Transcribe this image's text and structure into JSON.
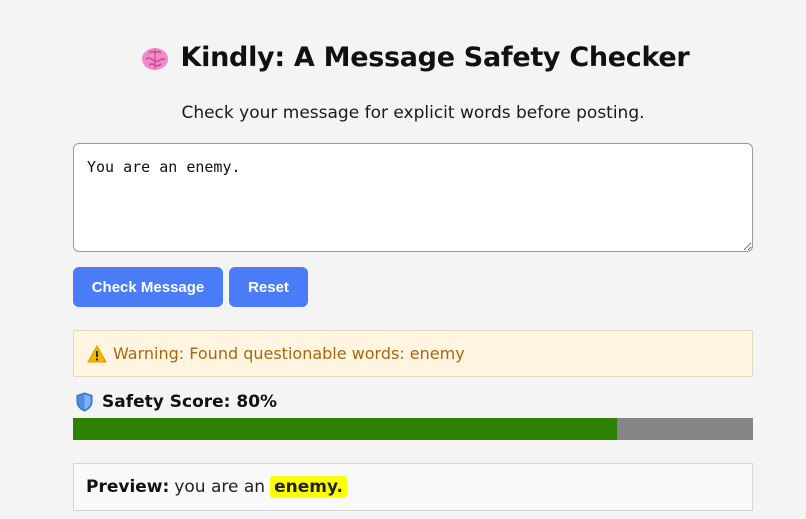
{
  "header": {
    "title": "Kindly: A Message Safety Checker",
    "title_icon": "brain-icon",
    "subtitle": "Check your message for explicit words before posting."
  },
  "message_input": {
    "value": "You are an enemy."
  },
  "buttons": {
    "check_label": "Check Message",
    "reset_label": "Reset"
  },
  "warning": {
    "icon": "warning-icon",
    "text": "Warning: Found questionable words: enemy"
  },
  "safety_score": {
    "icon": "shield-icon",
    "label": "Safety Score: 80%",
    "value": 0.8
  },
  "preview": {
    "label": "Preview:",
    "text": "you are an",
    "flagged": "enemy."
  },
  "colors": {
    "accent": "#4a7cf7",
    "score_fill": "#2e8203",
    "score_track": "#858585",
    "warning_bg": "#fff5e1",
    "warning_text": "#a4690f",
    "highlight": "#ffff00"
  }
}
